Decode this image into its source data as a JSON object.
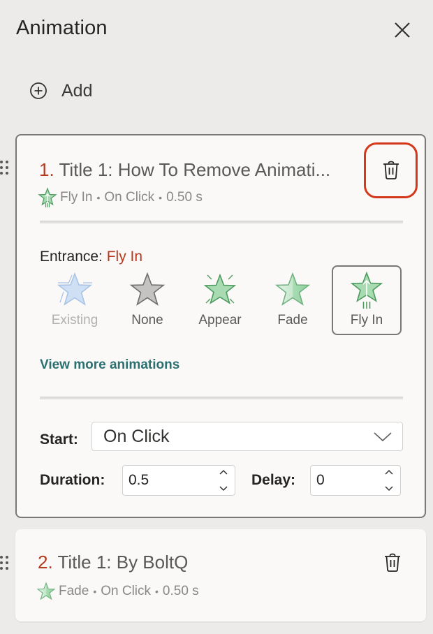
{
  "pane": {
    "title": "Animation",
    "close_icon": "close-icon",
    "add_label": "Add",
    "add_icon": "plus-circle-icon"
  },
  "items": [
    {
      "number": "1.",
      "title": "Title 1: How To Remove Animati...",
      "effect": "Fly In",
      "start": "On Click",
      "duration_text": "0.50 s",
      "separator": "•",
      "meta_icon": "fly-in-star-icon",
      "delete_icon": "trash-icon",
      "delete_highlighted": true,
      "expanded": true
    },
    {
      "number": "2.",
      "title": "Title 1: By BoltQ",
      "effect": "Fade",
      "start": "On Click",
      "duration_text": "0.50 s",
      "separator": "•",
      "meta_icon": "fade-star-icon",
      "delete_icon": "trash-icon",
      "expanded": false
    }
  ],
  "details": {
    "entrance_prefix": "Entrance:",
    "entrance_value": "Fly In",
    "effects": [
      {
        "label": "Existing",
        "icon": "existing-star-icon",
        "disabled": true,
        "selected": false
      },
      {
        "label": "None",
        "icon": "none-star-icon",
        "disabled": false,
        "selected": false
      },
      {
        "label": "Appear",
        "icon": "appear-star-icon",
        "disabled": false,
        "selected": false
      },
      {
        "label": "Fade",
        "icon": "fade-star-icon",
        "disabled": false,
        "selected": false
      },
      {
        "label": "Fly In",
        "icon": "fly-in-star-icon",
        "disabled": false,
        "selected": true
      }
    ],
    "view_more_label": "View more animations",
    "start_label": "Start:",
    "start_value": "On Click",
    "duration_label": "Duration:",
    "duration_value": "0.5",
    "delay_label": "Delay:",
    "delay_value": "0"
  },
  "colors": {
    "accent_red": "#b5391d",
    "highlight_red": "#d4381b",
    "link_teal": "#2b6f6f",
    "star_green": "#8fd19e",
    "star_blue": "#cfe0f5",
    "star_gray": "#c4c3c2"
  }
}
